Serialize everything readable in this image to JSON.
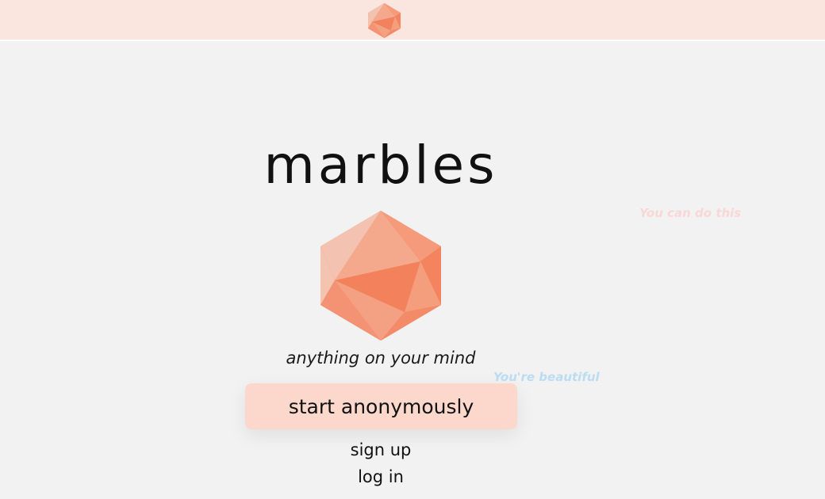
{
  "header": {
    "logo_icon": "icosahedron-logo-icon",
    "background_color": "#fae5df"
  },
  "hero": {
    "title": "marbles",
    "logo_icon": "icosahedron-logo-icon",
    "tagline": "anything on your mind"
  },
  "actions": {
    "start_label": "start anonymously",
    "signup_label": "sign up",
    "login_label": "log in",
    "button_color": "#fbd8cb"
  },
  "floating_messages": [
    {
      "text": "You can do this",
      "color": "#f9d7d6"
    },
    {
      "text": "You're beautiful",
      "color": "#bcdcf2"
    }
  ],
  "colors": {
    "background": "#f2f2f2",
    "accent": "#f4845f"
  }
}
